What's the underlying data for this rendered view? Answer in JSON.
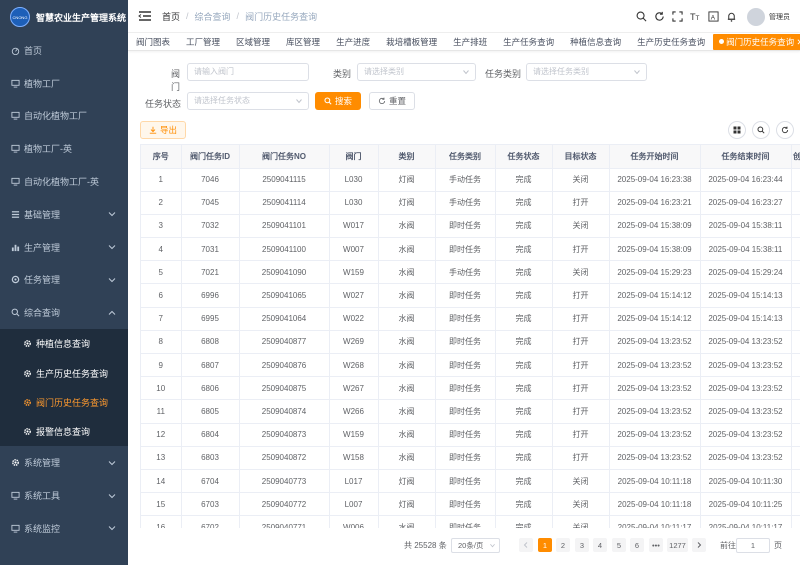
{
  "app": {
    "title": "智慧农业生产管理系统",
    "logo_text": "CNONG"
  },
  "sidebar": {
    "items": [
      {
        "label": "首页",
        "icon": "dashboard-icon"
      },
      {
        "label": "植物工厂",
        "icon": "monitor-icon"
      },
      {
        "label": "自动化植物工厂",
        "icon": "monitor-icon"
      },
      {
        "label": "植物工厂-英",
        "icon": "monitor-icon"
      },
      {
        "label": "自动化植物工厂-英",
        "icon": "monitor-icon"
      },
      {
        "label": "基础管理",
        "icon": "list-icon"
      },
      {
        "label": "生产管理",
        "icon": "chart-icon"
      },
      {
        "label": "任务管理",
        "icon": "tasks-icon"
      },
      {
        "label": "综合查询",
        "icon": "search-icon"
      },
      {
        "label": "种植信息查询",
        "icon": "gear-icon"
      },
      {
        "label": "生产历史任务查询",
        "icon": "gear-icon"
      },
      {
        "label": "阀门历史任务查询",
        "icon": "gear-icon"
      },
      {
        "label": "报警信息查询",
        "icon": "gear-icon"
      },
      {
        "label": "系统管理",
        "icon": "gear-icon"
      },
      {
        "label": "系统工具",
        "icon": "monitor-icon"
      },
      {
        "label": "系统监控",
        "icon": "monitor-icon"
      }
    ]
  },
  "breadcrumb": {
    "home": "首页",
    "mid": "综合查询",
    "current": "阀门历史任务查询"
  },
  "navbar": {
    "user": "管理员"
  },
  "tags": [
    "阀门图表",
    "工厂管理",
    "区域管理",
    "库区管理",
    "生产进度",
    "栽培槽板管理",
    "生产排班",
    "生产任务查询",
    "种植信息查询",
    "生产历史任务查询",
    "阀门历史任务查询"
  ],
  "form": {
    "valve_label": "阀门",
    "valve_placeholder": "请输入阀门",
    "type_label": "类别",
    "type_placeholder": "请选择类别",
    "task_type_label": "任务类别",
    "task_type_placeholder": "请选择任务类别",
    "task_status_label": "任务状态",
    "task_status_placeholder": "请选择任务状态",
    "search_label": "搜索",
    "reset_label": "重置"
  },
  "toolbar": {
    "export_label": "导出"
  },
  "table": {
    "columns": [
      "序号",
      "阀门任务ID",
      "阀门任务NO",
      "阀门",
      "类别",
      "任务类别",
      "任务状态",
      "目标状态",
      "任务开始时间",
      "任务结束时间",
      "创"
    ],
    "rows": [
      [
        "1",
        "7046",
        "2509041115",
        "L030",
        "灯阀",
        "手动任务",
        "完成",
        "关闭",
        "2025-09-04 16:23:38",
        "2025-09-04 16:23:44",
        ""
      ],
      [
        "2",
        "7045",
        "2509041114",
        "L030",
        "灯阀",
        "手动任务",
        "完成",
        "打开",
        "2025-09-04 16:23:21",
        "2025-09-04 16:23:27",
        ""
      ],
      [
        "3",
        "7032",
        "2509041101",
        "W017",
        "水阀",
        "即时任务",
        "完成",
        "关闭",
        "2025-09-04 15:38:09",
        "2025-09-04 15:38:11",
        ""
      ],
      [
        "4",
        "7031",
        "2509041100",
        "W007",
        "水阀",
        "即时任务",
        "完成",
        "打开",
        "2025-09-04 15:38:09",
        "2025-09-04 15:38:11",
        ""
      ],
      [
        "5",
        "7021",
        "2509041090",
        "W159",
        "水阀",
        "手动任务",
        "完成",
        "关闭",
        "2025-09-04 15:29:23",
        "2025-09-04 15:29:24",
        ""
      ],
      [
        "6",
        "6996",
        "2509041065",
        "W027",
        "水阀",
        "即时任务",
        "完成",
        "打开",
        "2025-09-04 15:14:12",
        "2025-09-04 15:14:13",
        ""
      ],
      [
        "7",
        "6995",
        "2509041064",
        "W022",
        "水阀",
        "即时任务",
        "完成",
        "打开",
        "2025-09-04 15:14:12",
        "2025-09-04 15:14:13",
        ""
      ],
      [
        "8",
        "6808",
        "2509040877",
        "W269",
        "水阀",
        "即时任务",
        "完成",
        "打开",
        "2025-09-04 13:23:52",
        "2025-09-04 13:23:52",
        ""
      ],
      [
        "9",
        "6807",
        "2509040876",
        "W268",
        "水阀",
        "即时任务",
        "完成",
        "打开",
        "2025-09-04 13:23:52",
        "2025-09-04 13:23:52",
        ""
      ],
      [
        "10",
        "6806",
        "2509040875",
        "W267",
        "水阀",
        "即时任务",
        "完成",
        "打开",
        "2025-09-04 13:23:52",
        "2025-09-04 13:23:52",
        ""
      ],
      [
        "11",
        "6805",
        "2509040874",
        "W266",
        "水阀",
        "即时任务",
        "完成",
        "打开",
        "2025-09-04 13:23:52",
        "2025-09-04 13:23:52",
        ""
      ],
      [
        "12",
        "6804",
        "2509040873",
        "W159",
        "水阀",
        "即时任务",
        "完成",
        "打开",
        "2025-09-04 13:23:52",
        "2025-09-04 13:23:52",
        ""
      ],
      [
        "13",
        "6803",
        "2509040872",
        "W158",
        "水阀",
        "即时任务",
        "完成",
        "打开",
        "2025-09-04 13:23:52",
        "2025-09-04 13:23:52",
        ""
      ],
      [
        "14",
        "6704",
        "2509040773",
        "L017",
        "灯阀",
        "即时任务",
        "完成",
        "关闭",
        "2025-09-04 10:11:18",
        "2025-09-04 10:11:30",
        ""
      ],
      [
        "15",
        "6703",
        "2509040772",
        "L007",
        "灯阀",
        "即时任务",
        "完成",
        "关闭",
        "2025-09-04 10:11:18",
        "2025-09-04 10:11:25",
        ""
      ],
      [
        "16",
        "6702",
        "2509040771",
        "W006",
        "水阀",
        "即时任务",
        "完成",
        "关闭",
        "2025-09-04 10:11:17",
        "2025-09-04 10:11:17",
        ""
      ]
    ]
  },
  "pagination": {
    "total_text": "共 25528 条",
    "page_size": "20条/页",
    "pages": [
      "1",
      "2",
      "3",
      "4",
      "5",
      "6",
      "•••",
      "1277"
    ],
    "current_page": "1",
    "jump_label": "前往",
    "jump_value": "1",
    "page_unit": "页"
  },
  "colors": {
    "sidebar_bg": "#304156",
    "accent": "#ff8c00",
    "sidebar_text": "#bfcbd9"
  }
}
